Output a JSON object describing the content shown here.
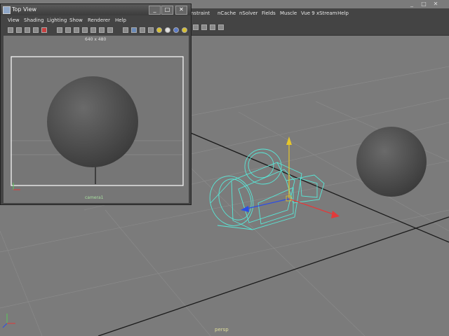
{
  "main": {
    "menu_items": [
      "nstraint",
      "nCache",
      "nSolver",
      "Fields",
      "Muscle",
      "Vue 9 xStream",
      "Help"
    ],
    "controls": {
      "minimize": "_",
      "maximize": "□",
      "close": "✕"
    },
    "viewport_label": "persp"
  },
  "top_view": {
    "title": "Top View",
    "menu_items": [
      "View",
      "Shading",
      "Lighting",
      "Show",
      "Renderer",
      "Help"
    ],
    "controls": {
      "minimize": "_",
      "maximize": "□",
      "close": "✕"
    },
    "resolution": "640 x 480",
    "camera_label": "camera1"
  },
  "colors": {
    "viewport_bg": "#7b7b7b",
    "wireframe": "#58e8d8",
    "grid_line": "#1a1a1a",
    "axis_x": "#e23a3a",
    "axis_y": "#e6c62b",
    "axis_z": "#2b4ee6",
    "resolution_gate": "#ffffff"
  }
}
